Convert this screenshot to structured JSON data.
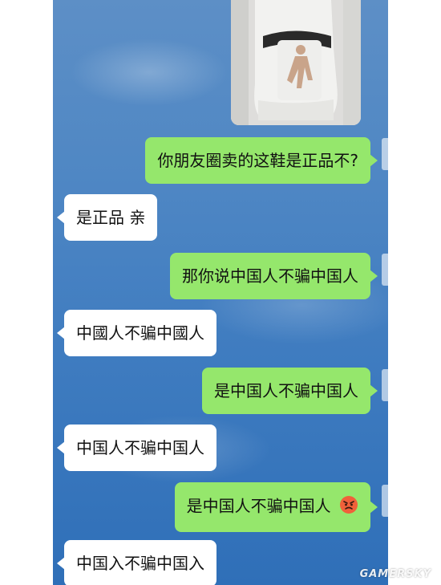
{
  "chat": {
    "messages": [
      {
        "side": "me",
        "text": "你朋友圈卖的这鞋是正品不?"
      },
      {
        "side": "them",
        "text": "是正品 亲"
      },
      {
        "side": "me",
        "text": "那你说中国人不骗中国人"
      },
      {
        "side": "them",
        "text": "中國人不骗中國人"
      },
      {
        "side": "me",
        "text": "是中国人不骗中国人"
      },
      {
        "side": "them",
        "text": "中国人不骗中国人"
      },
      {
        "side": "me",
        "text": "是中国人不骗中国人",
        "emoji": "angry-face-icon"
      },
      {
        "side": "them",
        "text": "中国入不骗中国入"
      }
    ]
  },
  "colors": {
    "sent_bubble": "#95e76c",
    "received_bubble": "#ffffff",
    "background": "#4f87c4"
  },
  "watermark": "GAMERSKY"
}
